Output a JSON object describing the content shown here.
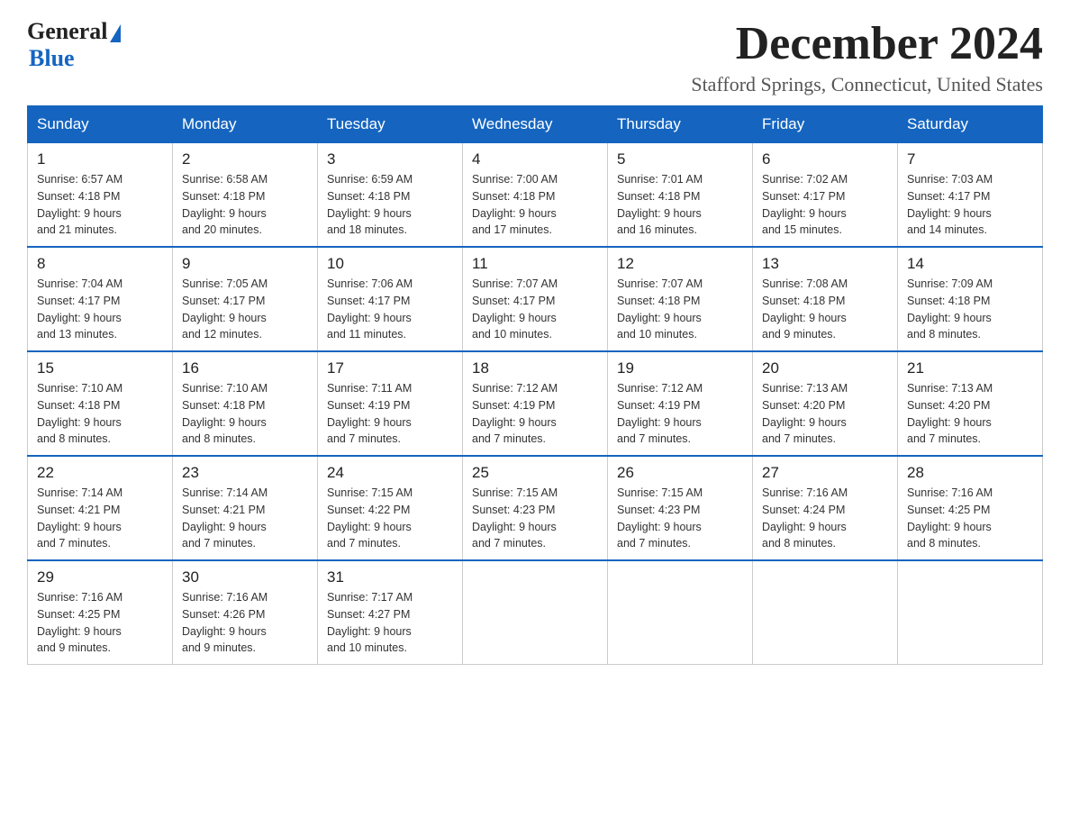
{
  "header": {
    "logo_general": "General",
    "logo_blue": "Blue",
    "month_title": "December 2024",
    "location": "Stafford Springs, Connecticut, United States"
  },
  "days_of_week": [
    "Sunday",
    "Monday",
    "Tuesday",
    "Wednesday",
    "Thursday",
    "Friday",
    "Saturday"
  ],
  "weeks": [
    [
      {
        "day": "1",
        "sunrise": "6:57 AM",
        "sunset": "4:18 PM",
        "daylight": "9 hours and 21 minutes."
      },
      {
        "day": "2",
        "sunrise": "6:58 AM",
        "sunset": "4:18 PM",
        "daylight": "9 hours and 20 minutes."
      },
      {
        "day": "3",
        "sunrise": "6:59 AM",
        "sunset": "4:18 PM",
        "daylight": "9 hours and 18 minutes."
      },
      {
        "day": "4",
        "sunrise": "7:00 AM",
        "sunset": "4:18 PM",
        "daylight": "9 hours and 17 minutes."
      },
      {
        "day": "5",
        "sunrise": "7:01 AM",
        "sunset": "4:18 PM",
        "daylight": "9 hours and 16 minutes."
      },
      {
        "day": "6",
        "sunrise": "7:02 AM",
        "sunset": "4:17 PM",
        "daylight": "9 hours and 15 minutes."
      },
      {
        "day": "7",
        "sunrise": "7:03 AM",
        "sunset": "4:17 PM",
        "daylight": "9 hours and 14 minutes."
      }
    ],
    [
      {
        "day": "8",
        "sunrise": "7:04 AM",
        "sunset": "4:17 PM",
        "daylight": "9 hours and 13 minutes."
      },
      {
        "day": "9",
        "sunrise": "7:05 AM",
        "sunset": "4:17 PM",
        "daylight": "9 hours and 12 minutes."
      },
      {
        "day": "10",
        "sunrise": "7:06 AM",
        "sunset": "4:17 PM",
        "daylight": "9 hours and 11 minutes."
      },
      {
        "day": "11",
        "sunrise": "7:07 AM",
        "sunset": "4:17 PM",
        "daylight": "9 hours and 10 minutes."
      },
      {
        "day": "12",
        "sunrise": "7:07 AM",
        "sunset": "4:18 PM",
        "daylight": "9 hours and 10 minutes."
      },
      {
        "day": "13",
        "sunrise": "7:08 AM",
        "sunset": "4:18 PM",
        "daylight": "9 hours and 9 minutes."
      },
      {
        "day": "14",
        "sunrise": "7:09 AM",
        "sunset": "4:18 PM",
        "daylight": "9 hours and 8 minutes."
      }
    ],
    [
      {
        "day": "15",
        "sunrise": "7:10 AM",
        "sunset": "4:18 PM",
        "daylight": "9 hours and 8 minutes."
      },
      {
        "day": "16",
        "sunrise": "7:10 AM",
        "sunset": "4:18 PM",
        "daylight": "9 hours and 8 minutes."
      },
      {
        "day": "17",
        "sunrise": "7:11 AM",
        "sunset": "4:19 PM",
        "daylight": "9 hours and 7 minutes."
      },
      {
        "day": "18",
        "sunrise": "7:12 AM",
        "sunset": "4:19 PM",
        "daylight": "9 hours and 7 minutes."
      },
      {
        "day": "19",
        "sunrise": "7:12 AM",
        "sunset": "4:19 PM",
        "daylight": "9 hours and 7 minutes."
      },
      {
        "day": "20",
        "sunrise": "7:13 AM",
        "sunset": "4:20 PM",
        "daylight": "9 hours and 7 minutes."
      },
      {
        "day": "21",
        "sunrise": "7:13 AM",
        "sunset": "4:20 PM",
        "daylight": "9 hours and 7 minutes."
      }
    ],
    [
      {
        "day": "22",
        "sunrise": "7:14 AM",
        "sunset": "4:21 PM",
        "daylight": "9 hours and 7 minutes."
      },
      {
        "day": "23",
        "sunrise": "7:14 AM",
        "sunset": "4:21 PM",
        "daylight": "9 hours and 7 minutes."
      },
      {
        "day": "24",
        "sunrise": "7:15 AM",
        "sunset": "4:22 PM",
        "daylight": "9 hours and 7 minutes."
      },
      {
        "day": "25",
        "sunrise": "7:15 AM",
        "sunset": "4:23 PM",
        "daylight": "9 hours and 7 minutes."
      },
      {
        "day": "26",
        "sunrise": "7:15 AM",
        "sunset": "4:23 PM",
        "daylight": "9 hours and 7 minutes."
      },
      {
        "day": "27",
        "sunrise": "7:16 AM",
        "sunset": "4:24 PM",
        "daylight": "9 hours and 8 minutes."
      },
      {
        "day": "28",
        "sunrise": "7:16 AM",
        "sunset": "4:25 PM",
        "daylight": "9 hours and 8 minutes."
      }
    ],
    [
      {
        "day": "29",
        "sunrise": "7:16 AM",
        "sunset": "4:25 PM",
        "daylight": "9 hours and 9 minutes."
      },
      {
        "day": "30",
        "sunrise": "7:16 AM",
        "sunset": "4:26 PM",
        "daylight": "9 hours and 9 minutes."
      },
      {
        "day": "31",
        "sunrise": "7:17 AM",
        "sunset": "4:27 PM",
        "daylight": "9 hours and 10 minutes."
      },
      null,
      null,
      null,
      null
    ]
  ],
  "labels": {
    "sunrise": "Sunrise:",
    "sunset": "Sunset:",
    "daylight": "Daylight:"
  }
}
